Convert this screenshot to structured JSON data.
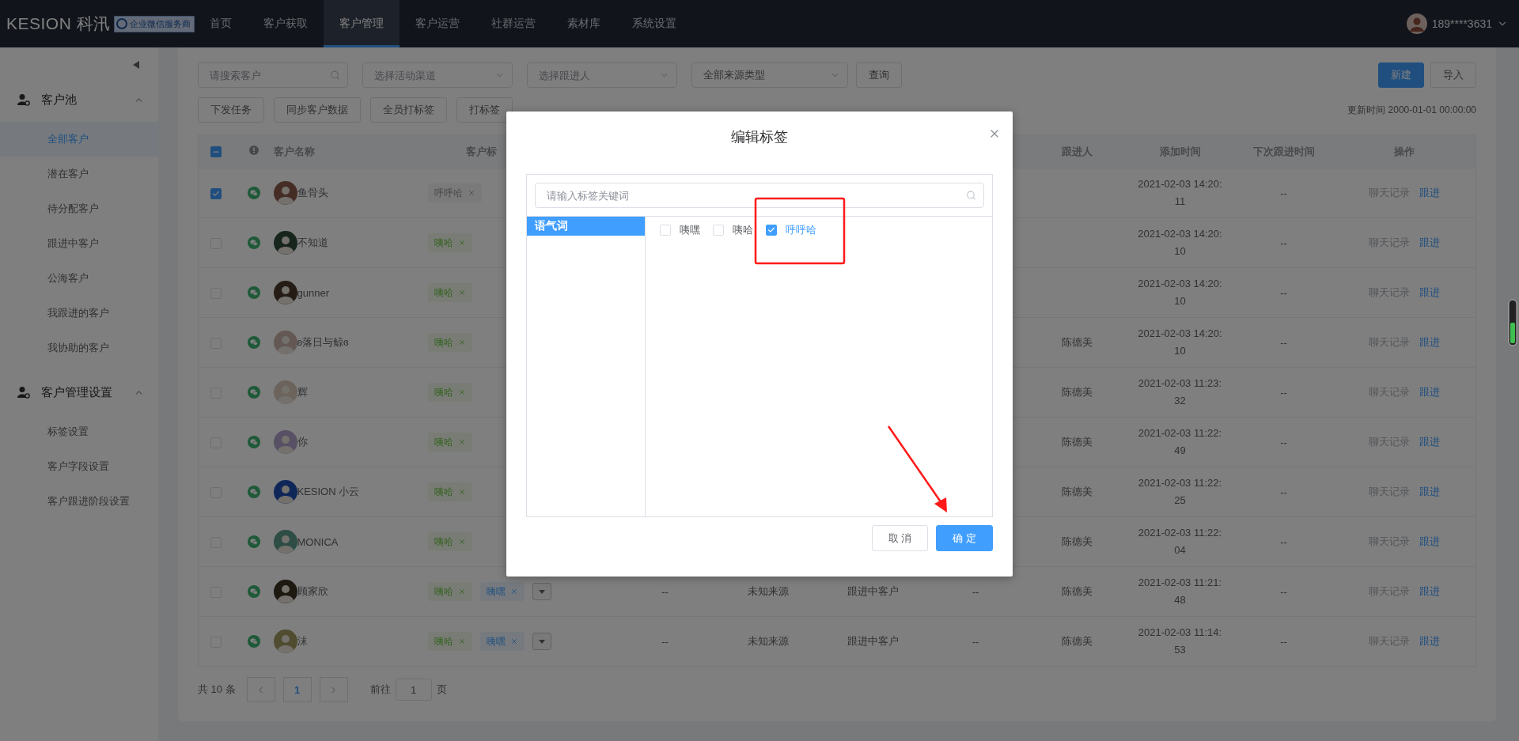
{
  "nav": {
    "logo": "KESION 科汛",
    "badge": "企业微信服务商",
    "items": [
      {
        "label": "首页",
        "selected": false
      },
      {
        "label": "客户获取",
        "selected": false
      },
      {
        "label": "客户管理",
        "selected": true
      },
      {
        "label": "客户运营",
        "selected": false
      },
      {
        "label": "社群运营",
        "selected": false
      },
      {
        "label": "素材库",
        "selected": false
      },
      {
        "label": "系统设置",
        "selected": false
      }
    ],
    "user": "189****3631"
  },
  "sidebar": {
    "groups": [
      {
        "title": "客户池",
        "expanded": true,
        "items": [
          {
            "label": "全部客户",
            "selected": true
          },
          {
            "label": "潜在客户",
            "selected": false
          },
          {
            "label": "待分配客户",
            "selected": false
          },
          {
            "label": "跟进中客户",
            "selected": false
          },
          {
            "label": "公海客户",
            "selected": false
          },
          {
            "label": "我跟进的客户",
            "selected": false
          },
          {
            "label": "我协助的客户",
            "selected": false
          }
        ]
      },
      {
        "title": "客户管理设置",
        "expanded": true,
        "items": [
          {
            "label": "标签设置",
            "selected": false
          },
          {
            "label": "客户字段设置",
            "selected": false
          },
          {
            "label": "客户跟进阶段设置",
            "selected": false
          }
        ]
      }
    ]
  },
  "filters": {
    "search_placeholder": "请搜索客户",
    "channel_placeholder": "选择活动渠道",
    "follower_placeholder": "选择跟进人",
    "source_value": "全部来源类型",
    "query": "查询",
    "new": "新建",
    "import": "导入"
  },
  "actions": [
    "下发任务",
    "同步客户数据",
    "全员打标签",
    "打标签"
  ],
  "updated": "更新时间 2000-01-01 00:00:00",
  "table": {
    "select_all_indeterminate": true,
    "headers": {
      "name": "客户名称",
      "tags": "客户标",
      "follower": "跟进人",
      "added": "添加时间",
      "next": "下次跟进时间",
      "ops": "操作"
    },
    "rows": [
      {
        "checked": true,
        "name": "鱼骨头",
        "tags": [
          {
            "label": "呼呼哈",
            "kind": "gray"
          }
        ],
        "added": "2021-02-03 14:20:11",
        "next": "--",
        "chat": "聊天记录",
        "chat_disabled": true,
        "follow": "跟进"
      },
      {
        "checked": false,
        "name": "不知道",
        "tags": [
          {
            "label": "咦哈",
            "kind": "green"
          }
        ],
        "added": "2021-02-03 14:20:10",
        "next": "--",
        "chat": "聊天记录",
        "chat_disabled": true,
        "follow": "跟进"
      },
      {
        "checked": false,
        "name": "gunner",
        "tags": [
          {
            "label": "咦哈",
            "kind": "green"
          }
        ],
        "added": "2021-02-03 14:20:10",
        "next": "--",
        "chat": "聊天记录",
        "chat_disabled": true,
        "follow": "跟进"
      },
      {
        "checked": false,
        "name": "ʚ落日与鲸ɞ",
        "tags": [
          {
            "label": "咦哈",
            "kind": "green"
          }
        ],
        "follower": "陈德美",
        "added": "2021-02-03 14:20:10",
        "next": "--",
        "chat": "聊天记录",
        "chat_disabled": true,
        "follow": "跟进"
      },
      {
        "checked": false,
        "name": "辉",
        "tags": [
          {
            "label": "咦哈",
            "kind": "green"
          }
        ],
        "follower": "陈德美",
        "added": "2021-02-03 11:23:32",
        "next": "--",
        "chat": "聊天记录",
        "chat_disabled": true,
        "follow": "跟进"
      },
      {
        "checked": false,
        "name": "你",
        "tags": [
          {
            "label": "咦哈",
            "kind": "green"
          }
        ],
        "follower": "陈德美",
        "added": "2021-02-03 11:22:49",
        "next": "--",
        "chat": "聊天记录",
        "chat_disabled": true,
        "follow": "跟进"
      },
      {
        "checked": false,
        "name": "KESION 小云",
        "tags": [
          {
            "label": "咦哈",
            "kind": "green"
          }
        ],
        "follower": "陈德美",
        "added": "2021-02-03 11:22:25",
        "next": "--",
        "chat": "聊天记录",
        "chat_disabled": true,
        "follow": "跟进"
      },
      {
        "checked": false,
        "name": "MONICA",
        "tags": [
          {
            "label": "咦哈",
            "kind": "green"
          }
        ],
        "follower": "陈德美",
        "added": "2021-02-03 11:22:04",
        "next": "--",
        "chat": "聊天记录",
        "chat_disabled": true,
        "follow": "跟进"
      },
      {
        "checked": false,
        "name": "顾家欣",
        "tags": [
          {
            "label": "咦哈",
            "kind": "green"
          },
          {
            "label": "咦嘿",
            "kind": "blue"
          }
        ],
        "more": true,
        "column_5": "--",
        "source": "未知来源",
        "stage": "跟进中客户",
        "column_8": "--",
        "follower": "陈德美",
        "added": "2021-02-03 11:21:48",
        "next": "--",
        "chat": "聊天记录",
        "chat_disabled": true,
        "follow": "跟进"
      },
      {
        "checked": false,
        "name": "沫",
        "tags": [
          {
            "label": "咦哈",
            "kind": "green"
          },
          {
            "label": "咦嘿",
            "kind": "blue"
          }
        ],
        "more": true,
        "column_5": "--",
        "source": "未知来源",
        "stage": "跟进中客户",
        "column_8": "--",
        "follower": "陈德美",
        "added": "2021-02-03 11:14:53",
        "next": "--",
        "chat": "聊天记录",
        "chat_disabled": true,
        "follow": "跟进"
      }
    ]
  },
  "pagination": {
    "total": "共 10 条",
    "pages": [
      {
        "label": "1",
        "selected": true
      }
    ],
    "goto": "前往",
    "goto_value": "1",
    "suffix": "页"
  },
  "dialog": {
    "title": "编辑标签",
    "search_placeholder": "请输入标签关键词",
    "categories": [
      {
        "label": "语气词",
        "selected": true
      }
    ],
    "options": [
      {
        "label": "咦嘿",
        "checked": false
      },
      {
        "label": "咦哈",
        "checked": false
      },
      {
        "label": "呼呼哈",
        "checked": true
      }
    ],
    "cancel": "取 消",
    "confirm": "确 定"
  }
}
